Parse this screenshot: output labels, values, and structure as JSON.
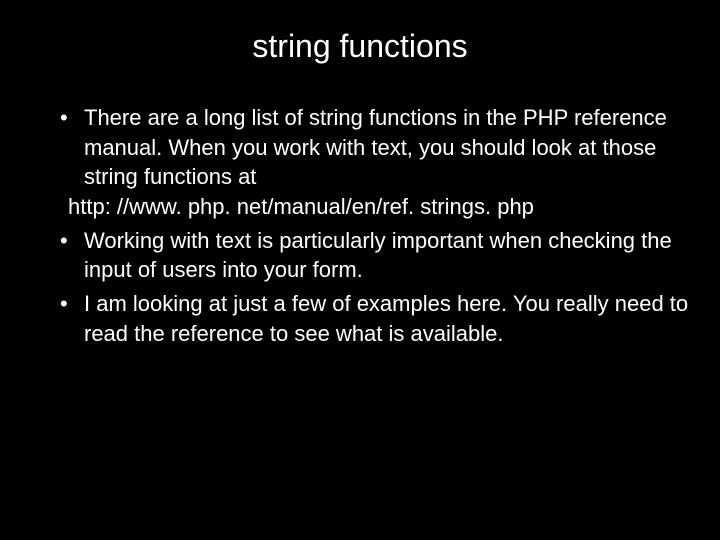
{
  "slide": {
    "title": "string functions",
    "bullets": [
      {
        "text": "There are a long list of string functions in the PHP reference manual. When you work with text, you should look at those string functions at",
        "sub": "http: //www. php. net/manual/en/ref. strings. php"
      },
      {
        "text": "Working with text is particularly important when checking the input of users into your form."
      },
      {
        "text": "I am looking at just a few of examples here. You really need to read the reference to see what is available."
      }
    ]
  }
}
